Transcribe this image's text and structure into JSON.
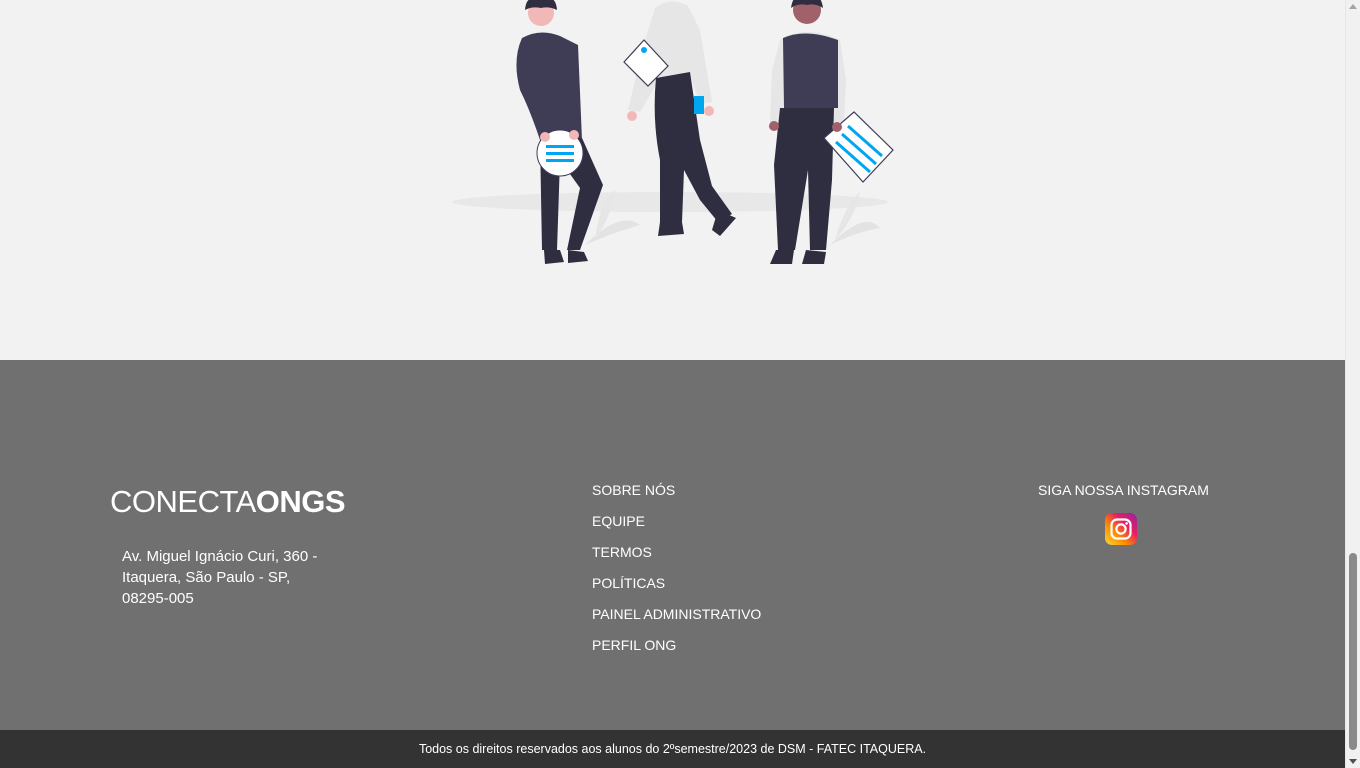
{
  "colors": {
    "page_background": "#f2f2f2",
    "footer_background": "#707070",
    "bottom_bar_background": "#333333",
    "text": "#ffffff"
  },
  "hero": {
    "illustration": "team-of-three-people-illustration"
  },
  "footer": {
    "logo_light": "CONECTA",
    "logo_bold": "ONGS",
    "address_line1": "Av. Miguel Ignácio Curi, 360 -",
    "address_line2": "Itaquera, São Paulo - SP,",
    "address_line3": "08295-005",
    "links": [
      {
        "label": "SOBRE NÓS"
      },
      {
        "label": "EQUIPE"
      },
      {
        "label": "TERMOS"
      },
      {
        "label": "POLÍTICAS"
      },
      {
        "label": "PAINEL ADMINISTRATIVO"
      },
      {
        "label": "PERFIL ONG"
      }
    ],
    "social_title": "SIGA NOSSA INSTAGRAM",
    "social_icon": "instagram-icon"
  },
  "bottom_bar": {
    "copyright": "Todos os direitos reservados aos alunos do 2ºsemestre/2023 de DSM - FATEC ITAQUERA."
  }
}
